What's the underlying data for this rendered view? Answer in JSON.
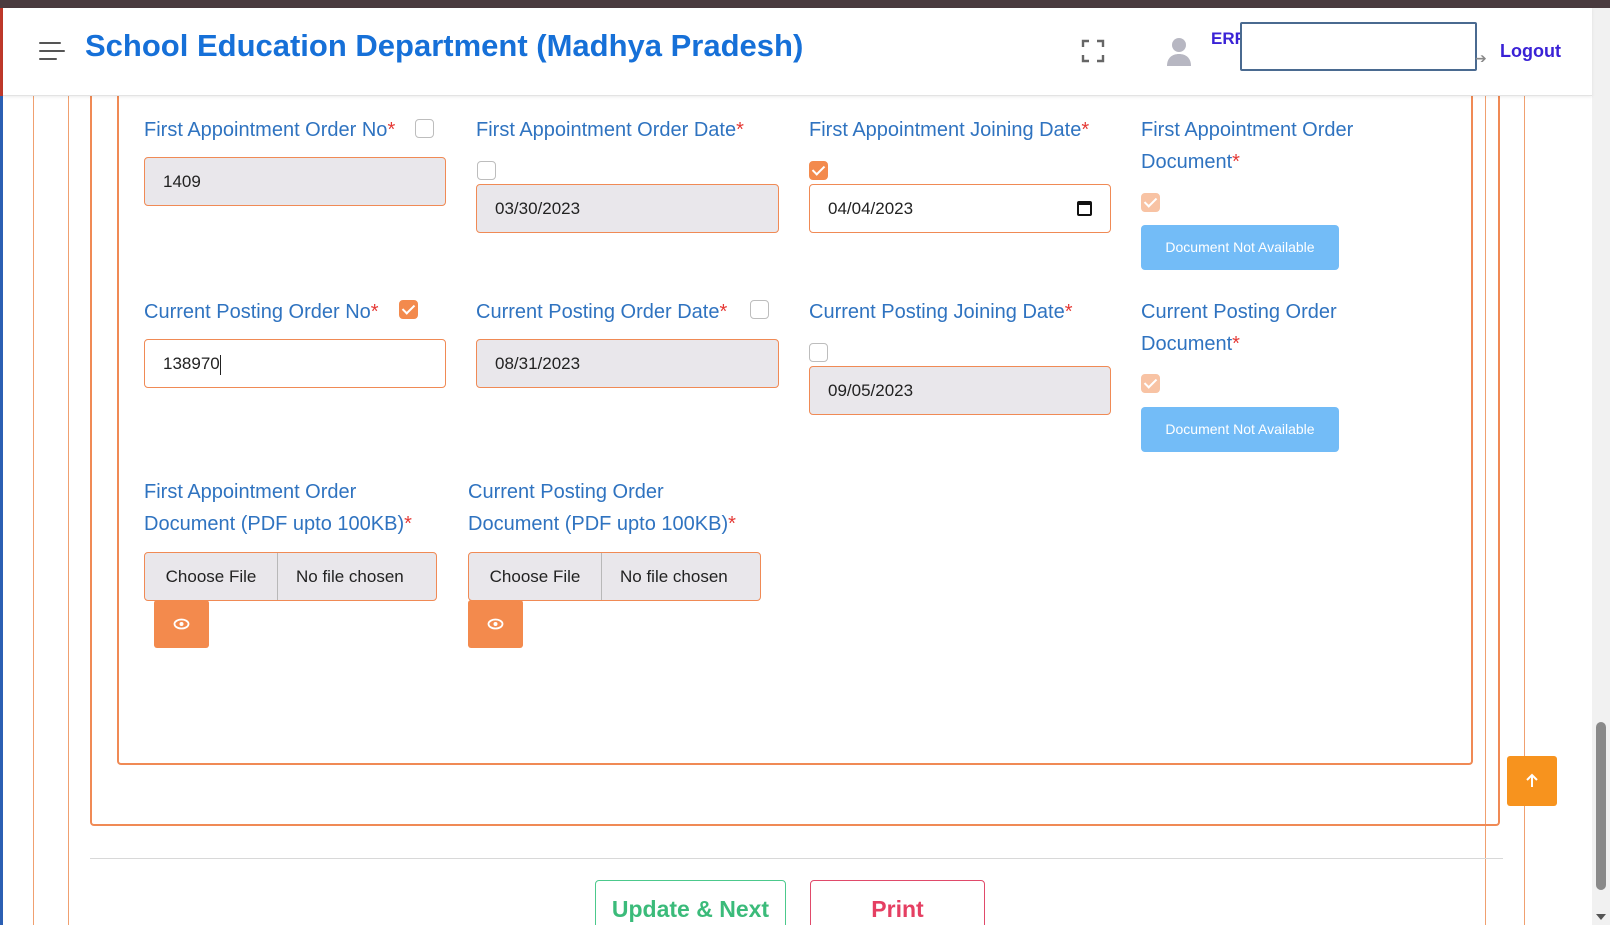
{
  "header": {
    "title": "School Education Department (Madhya Pradesh)",
    "user_code": "ERF",
    "logout_label": "Logout"
  },
  "form": {
    "required_mark": "*",
    "first_appointment_order_no": {
      "label": "First Appointment Order No",
      "value": "1409",
      "checked": false
    },
    "first_appointment_order_date": {
      "label": "First Appointment Order Date",
      "value": "03/30/2023",
      "checked": false
    },
    "first_appointment_joining_date": {
      "label": "First Appointment Joining Date",
      "value": "04/04/2023",
      "checked": true
    },
    "first_appointment_order_document": {
      "label_line1": "First Appointment Order",
      "label_line2": "Document",
      "button": "Document Not Available",
      "checked": true
    },
    "current_posting_order_no": {
      "label": "Current Posting Order No",
      "value": "138970",
      "checked": true
    },
    "current_posting_order_date": {
      "label": "Current Posting Order Date",
      "value": "08/31/2023",
      "checked": false
    },
    "current_posting_joining_date": {
      "label": "Current Posting Joining Date",
      "value": "09/05/2023",
      "checked": false
    },
    "current_posting_order_document": {
      "label_line1": "Current Posting Order",
      "label_line2": "Document",
      "button": "Document Not Available",
      "checked": true
    },
    "first_appointment_upload": {
      "label_line1": "First Appointment Order",
      "label_line2": "Document (PDF upto 100KB)",
      "choose_label": "Choose File",
      "status": "No file chosen"
    },
    "current_posting_upload": {
      "label_line1": "Current Posting Order",
      "label_line2": "Document (PDF upto 100KB)",
      "choose_label": "Choose File",
      "status": "No file chosen"
    }
  },
  "actions": {
    "update_next": "Update & Next",
    "print": "Print"
  },
  "colors": {
    "brand_blue": "#1670d8",
    "label_blue": "#2f73c0",
    "accent_orange": "#f38a4d",
    "doc_button_blue": "#73bcf7",
    "success_green": "#3bbb7a",
    "danger_red": "#e53f62"
  },
  "icons": [
    "menu-icon",
    "fullscreen-icon",
    "user-icon",
    "logout-icon",
    "calendar-icon",
    "eye-icon",
    "arrow-up-icon"
  ]
}
